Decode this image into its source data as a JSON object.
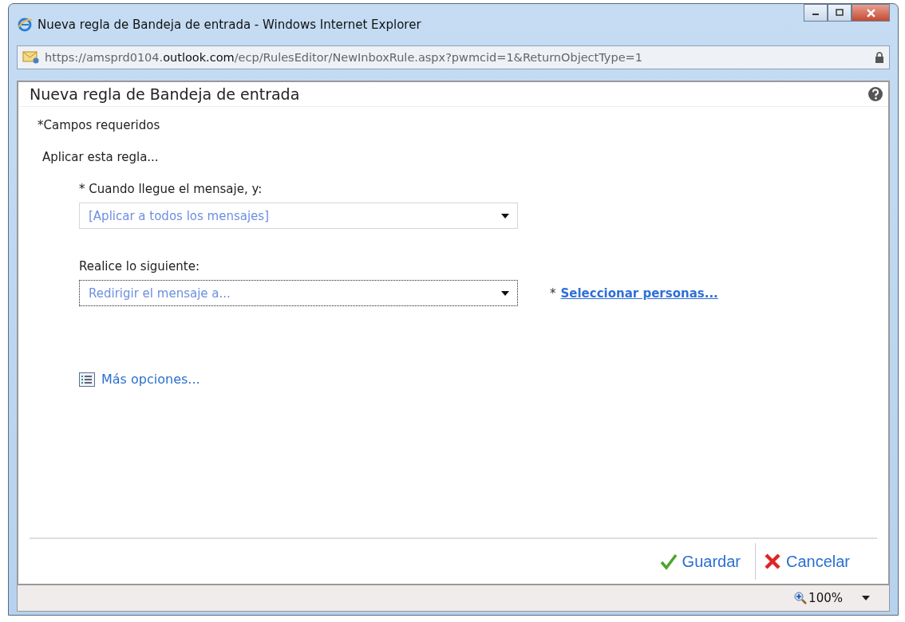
{
  "window": {
    "title": "Nueva regla de Bandeja de entrada - Windows Internet Explorer"
  },
  "address_bar": {
    "url": "https://amsprd0104.**outlook.com**/ecp/RulesEditor/NewInboxRule.aspx?pwmcid=1&ReturnObjectType=1"
  },
  "dialog": {
    "title": "Nueva regla de Bandeja de entrada",
    "required_note": "*Campos requeridos",
    "section_label": "Aplicar esta regla..."
  },
  "fields": [
    {
      "label": "* Cuando llegue el mensaje, y:",
      "value": "[Aplicar a todos los mensajes]",
      "focused": false
    },
    {
      "label": "Realice lo siguiente:",
      "value": "Redirigir el mensaje a...",
      "focused": true,
      "required_mark": "*",
      "link": "Seleccionar personas..."
    }
  ],
  "more_options": "Más opciones...",
  "buttons": [
    {
      "kind": "save",
      "label": "Guardar"
    },
    {
      "kind": "cancel",
      "label": "Cancelar"
    }
  ],
  "status_bar": {
    "zoom": "100%"
  }
}
